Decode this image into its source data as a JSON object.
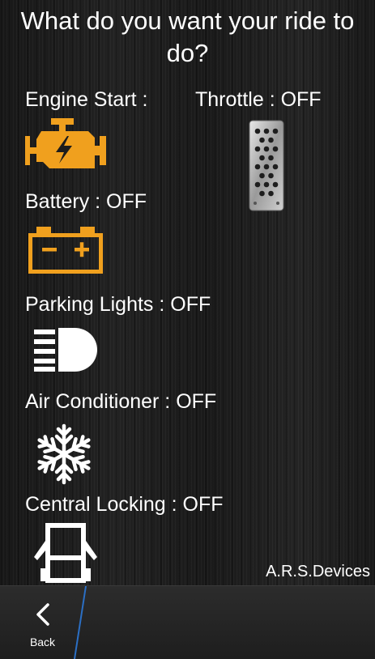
{
  "title": "What do you want your ride to do?",
  "controls": {
    "engine": {
      "label": "Engine Start :",
      "icon": "engine-icon"
    },
    "throttle": {
      "label": "Throttle : OFF",
      "icon": "pedal-icon"
    },
    "battery": {
      "label": "Battery : OFF",
      "icon": "battery-icon"
    },
    "parking_lights": {
      "label": "Parking Lights : OFF",
      "icon": "headlight-icon"
    },
    "air_conditioner": {
      "label": "Air Conditioner : OFF",
      "icon": "snowflake-icon"
    },
    "central_locking": {
      "label": "Central Locking : OFF",
      "icon": "car-door-icon"
    }
  },
  "brand": "A.R.S.Devices",
  "bottom_bar": {
    "back_label": "Back"
  },
  "colors": {
    "accent": "#f0a01e",
    "background": "#1c1c1c",
    "divider": "#2b6fc4"
  }
}
